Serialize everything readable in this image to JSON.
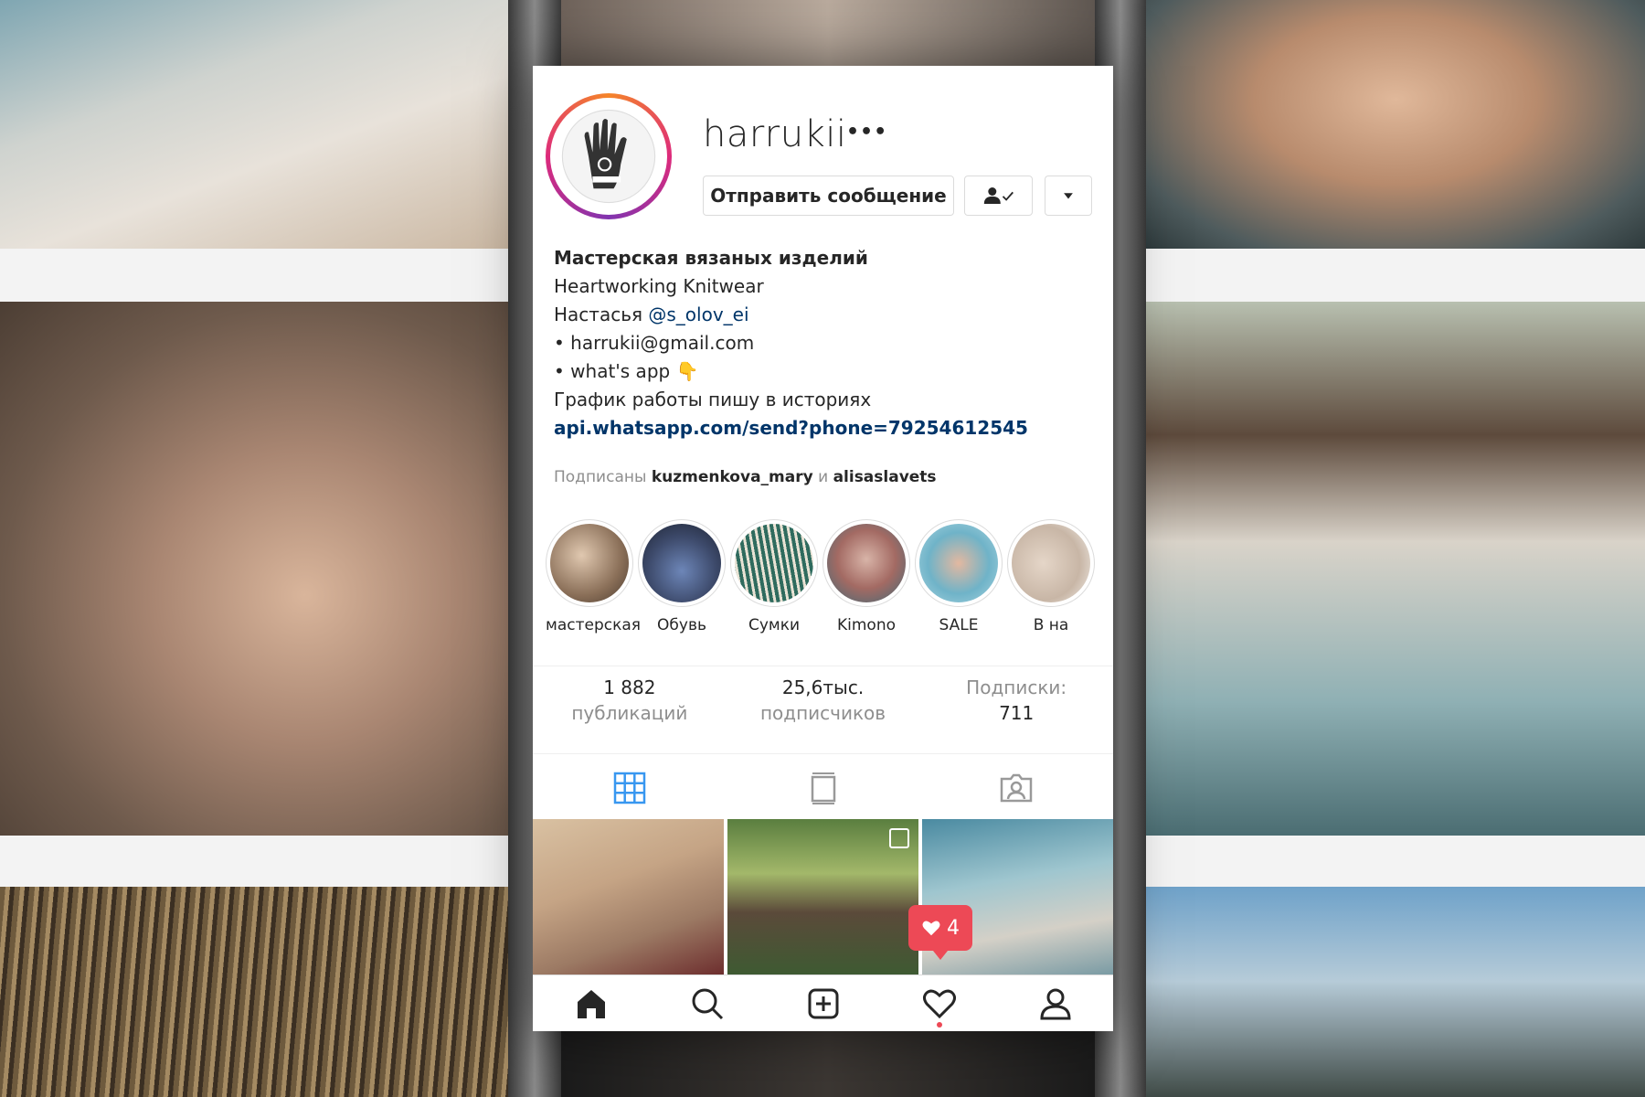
{
  "profile": {
    "username": "harrukii",
    "more_label": "•••",
    "message_button": "Отправить сообщение",
    "follow_icon_label": "✔",
    "dropdown_icon": "▾"
  },
  "bio": {
    "name": "Мастерская вязаных изделий",
    "line1": "Heartworking Knitwear",
    "line2_prefix": "Настасья ",
    "line2_mention": "@s_olov_ei",
    "line3": "• harrukii@gmail.com",
    "line4": "• what's app 👇",
    "line5": "График работы пишу в историях",
    "link": "api.whatsapp.com/send?phone=79254612545"
  },
  "followed_by": {
    "prefix": "Подписаны ",
    "user1": "kuzmenkova_mary",
    "and": " и ",
    "user2": "alisaslavets"
  },
  "highlights": [
    {
      "label": "мастерская",
      "color": "#8a6f58"
    },
    {
      "label": "Обувь",
      "color": "#3d4a6b"
    },
    {
      "label": "Сумки",
      "color": "#2f6b5e"
    },
    {
      "label": "Kimono",
      "color": "#a36a63"
    },
    {
      "label": "SALE",
      "color": "#6fb3c8"
    },
    {
      "label": "В на",
      "color": "#c8b6a6"
    }
  ],
  "stats": {
    "posts_num": "1 882",
    "posts_label": "публикаций",
    "followers_num": "25,6тыс.",
    "followers_label": "подписчиков",
    "following_label": "Подписки:",
    "following_num": "711"
  },
  "notification": {
    "likes": "4"
  },
  "colors": {
    "link": "#003569",
    "accent_blue": "#3897f0",
    "like_red": "#ed4956"
  },
  "icons": {
    "home": "home-icon",
    "search": "search-icon",
    "add": "add-post-icon",
    "activity": "heart-icon",
    "profile": "profile-icon"
  }
}
